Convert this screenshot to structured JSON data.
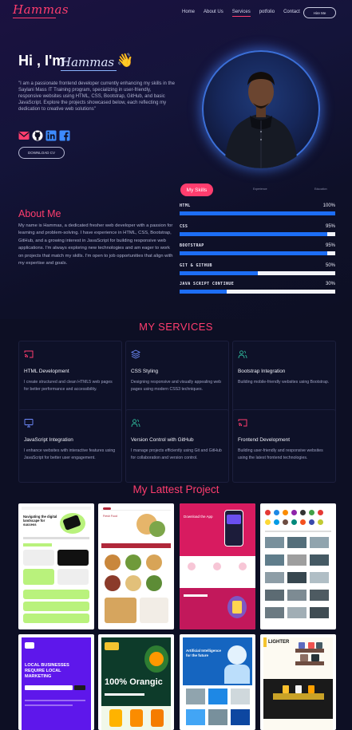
{
  "nav": {
    "logo": "Hammas",
    "links": [
      "Home",
      "About Us",
      "Services",
      "potfolio",
      "Contact"
    ],
    "active": "Services",
    "hire_label": "Hire Me"
  },
  "hero": {
    "greeting": "Hi , I'm",
    "name": "Hammas",
    "wave": "👋",
    "bio": "\"I am a passionate frontend developer currently enhancing my skills in the Saylani Mass IT Training program, specializing in user-friendly, responsive websites using HTML, CSS, Bootstrap, GitHub, and basic JavaScript. Explore the projects showcased below, each reflecting my dedication to creative web solutions\"",
    "download_label": "DOWNLOAD CV",
    "social_icons": [
      "mail-icon",
      "github-icon",
      "linkedin-icon",
      "facebook-icon"
    ]
  },
  "skills": {
    "tabs": [
      "My Skills",
      "Experience",
      "Education"
    ],
    "items": [
      {
        "name": "HTML",
        "percent": 100,
        "label": "100%"
      },
      {
        "name": "CSS",
        "percent": 95,
        "label": "95%"
      },
      {
        "name": "BOOTSTRAP",
        "percent": 95,
        "label": "95%"
      },
      {
        "name": "GIT & GITHUB",
        "percent": 50,
        "label": "50%"
      },
      {
        "name": "JAVA SCRIPT CONTINUE",
        "percent": 30,
        "label": "30%"
      }
    ]
  },
  "about": {
    "title": "About Me",
    "text": "My name is Hammas, a dedicated fresher web developer with a passion for learning and problem-solving. I have experience in HTML, CSS, Bootstrap, GitHub, and a growing interest in JavaScript for building responsive web applications. I'm always exploring new technologies and am eager to work on projects that match my skills. I'm open to job opportunities that align with my expertise and goals."
  },
  "services": {
    "title": "MY SERVICES",
    "items": [
      {
        "title": "HTML Development",
        "text": "I create structured and clean HTML5 web pages for better performance and accessibility.",
        "icon": "cast-icon",
        "color": "#ff3d6e"
      },
      {
        "title": "CSS Styling",
        "text": "Designing responsive and visually appealing web pages using modern CSS3 techniques.",
        "icon": "layers-icon",
        "color": "#6f8cff"
      },
      {
        "title": "Bootstrap Integration",
        "text": "Building mobile-friendly websites using Bootstrap.",
        "icon": "users-icon",
        "color": "#2fb89a"
      },
      {
        "title": "JavaScript Integration",
        "text": "I enhance websites with interactive features using JavaScript for better user engagement.",
        "icon": "monitor-icon",
        "color": "#6f8cff"
      },
      {
        "title": "Version Control with GitHub",
        "text": "I manage projects efficiently using Git and GitHub for collaboration and version control.",
        "icon": "users-icon",
        "color": "#2fb89a"
      },
      {
        "title": "Frontend Development",
        "text": "Building user-friendly and responsive websites using the latest frontend technologies.",
        "icon": "cast-icon",
        "color": "#ff3d6e"
      }
    ]
  },
  "projects": {
    "title": "My Lattest Project",
    "cards": [
      {
        "name": "project-marketing-landing",
        "banner": "Navigating the digital landscape for success"
      },
      {
        "name": "project-food-site",
        "banner": "Fresh Food"
      },
      {
        "name": "project-app-landing",
        "banner": "Download the App"
      },
      {
        "name": "project-car-marketplace",
        "banner": ""
      },
      {
        "name": "project-local-business",
        "banner": "LOCAL BUSINESSES REQUIRE LOCAL MARKETING"
      },
      {
        "name": "project-orange-juice",
        "banner": "100% Orangic"
      },
      {
        "name": "project-ai-robot",
        "banner": "Artificial Intelligence for the future"
      },
      {
        "name": "project-lighter-shop",
        "banner": "LIGHTER"
      }
    ]
  }
}
